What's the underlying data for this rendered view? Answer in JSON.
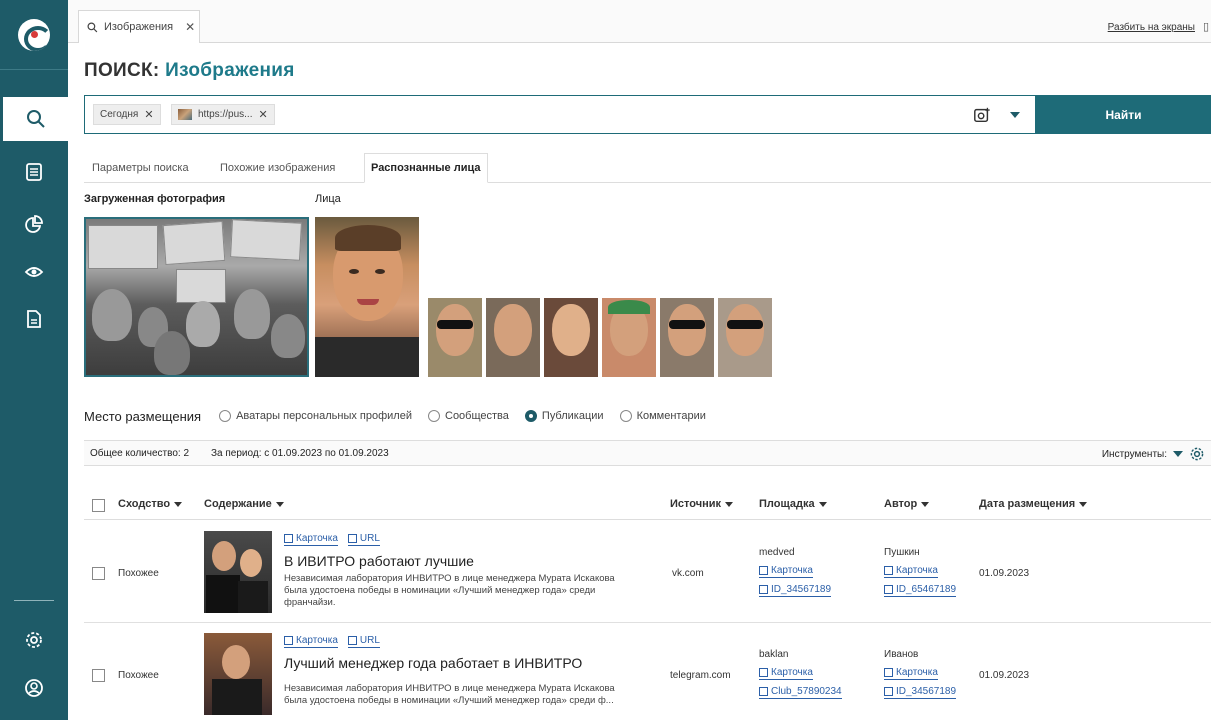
{
  "app": {
    "accent": "#1e5b68",
    "button_color": "#1e6b78",
    "link_color": "#2b5fa8"
  },
  "sidebar": {
    "icons": [
      "logo",
      "search-icon",
      "list-icon",
      "chart-pie-icon",
      "eye-icon",
      "document-icon",
      "gear-icon",
      "user-icon"
    ]
  },
  "tabbar": {
    "tab_label": "Изображения",
    "split_label": "Разбить на экраны"
  },
  "page": {
    "title_prefix": "ПОИСК:",
    "title_main": "Изображения"
  },
  "search": {
    "chips": [
      {
        "label": "Сегодня"
      },
      {
        "label": "https://pus..."
      }
    ],
    "find_label": "Найти"
  },
  "subtabs": [
    {
      "label": "Параметры поиска"
    },
    {
      "label": "Похожие изображения"
    },
    {
      "label": "Распознанные лица",
      "active": true
    }
  ],
  "faces": {
    "uploaded_label": "Загруженная фотография",
    "faces_label": "Лица",
    "face_count": 7
  },
  "placement": {
    "title": "Место размещения",
    "options": [
      {
        "label": "Аватары персональных профилей",
        "checked": false
      },
      {
        "label": "Сообщества",
        "checked": false
      },
      {
        "label": "Публикации",
        "checked": true
      },
      {
        "label": "Комментарии",
        "checked": false
      }
    ]
  },
  "summary": {
    "total": "Общее количество: 2",
    "period": "За период: с 01.09.2023 по 01.09.2023",
    "tools": "Инструменты:"
  },
  "table": {
    "headers": [
      "Сходство",
      "Содержание",
      "Источник",
      "Площадка",
      "Автор",
      "Дата размещения"
    ],
    "card_label": "Карточка",
    "url_label": "URL",
    "rows": [
      {
        "similarity": "Похожее",
        "title": "В ИВИТРО работают лучшие",
        "desc1": "Независимая лаборатория ИНВИТРО в лице менеджера Мурата Искакова",
        "desc2": "была удостоена победы в номинации «Лучший менеджер года» среди",
        "desc3": "франчайзи.",
        "source": "vk.com",
        "platform_name": "medved",
        "platform_id": "ID_34567189",
        "author_name": "Пушкин",
        "author_id": "ID_65467189",
        "date": "01.09.2023"
      },
      {
        "similarity": "Похожее",
        "title": "Лучший менеджер года работает в ИНВИТРО",
        "desc1": "Независимая лаборатория ИНВИТРО в лице менеджера Мурата Искакова",
        "desc2": "была удостоена победы в номинации «Лучший менеджер года» среди ф...",
        "desc3": "",
        "source": "telegram.com",
        "platform_name": "baklan",
        "platform_id": "Club_57890234",
        "author_name": "Иванов",
        "author_id": "ID_34567189",
        "date": "01.09.2023"
      }
    ]
  }
}
